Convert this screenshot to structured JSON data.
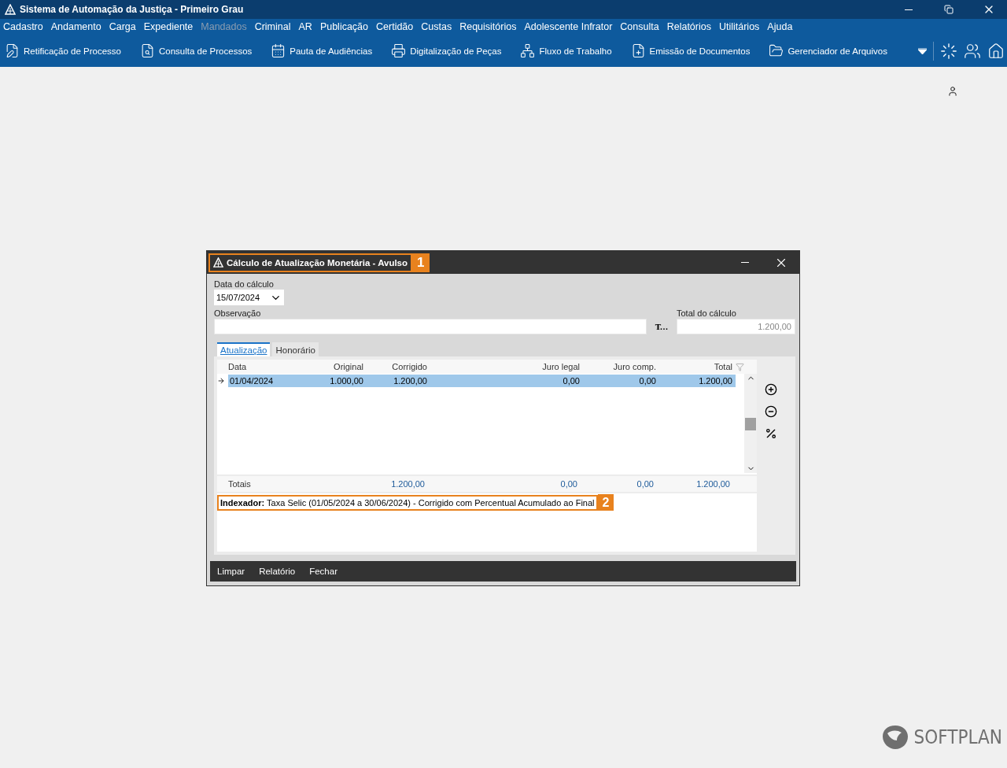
{
  "window": {
    "title": "Sistema de Automação da Justiça - Primeiro Grau"
  },
  "menu": [
    {
      "label": "Cadastro",
      "disabled": false
    },
    {
      "label": "Andamento",
      "disabled": false
    },
    {
      "label": "Carga",
      "disabled": false
    },
    {
      "label": "Expediente",
      "disabled": false
    },
    {
      "label": "Mandados",
      "disabled": true
    },
    {
      "label": "Criminal",
      "disabled": false
    },
    {
      "label": "AR",
      "disabled": false
    },
    {
      "label": "Publicação",
      "disabled": false
    },
    {
      "label": "Certidão",
      "disabled": false
    },
    {
      "label": "Custas",
      "disabled": false
    },
    {
      "label": "Requisitórios",
      "disabled": false
    },
    {
      "label": "Adolescente Infrator",
      "disabled": false
    },
    {
      "label": "Consulta",
      "disabled": false
    },
    {
      "label": "Relatórios",
      "disabled": false
    },
    {
      "label": "Utilitários",
      "disabled": false
    },
    {
      "label": "Ajuda",
      "disabled": false
    }
  ],
  "toolbar": [
    {
      "label": "Retificação de Processo",
      "kind": "edit"
    },
    {
      "label": "Consulta de Processos",
      "kind": "search"
    },
    {
      "label": "Pauta de Audiências",
      "kind": "calendar"
    },
    {
      "label": "Digitalização de Peças",
      "kind": "scanner"
    },
    {
      "label": "Fluxo de Trabalho",
      "kind": "flow"
    },
    {
      "label": "Emissão de Documentos",
      "kind": "document"
    },
    {
      "label": "Gerenciador de Arquivos",
      "kind": "folder"
    }
  ],
  "dialog": {
    "title": "Cálculo de Atualização Monetária - Avulso",
    "title_marker": "1",
    "date_label": "Data do cálculo",
    "date_value": "15/07/2024",
    "observation_label": "Observação",
    "text_button": "T...",
    "total_label": "Total do cálculo",
    "total_value": "1.200,00",
    "tabs": [
      {
        "label": "Atualização",
        "selected": true
      },
      {
        "label": "Honorário",
        "selected": false
      }
    ],
    "table": {
      "columns": [
        "Data",
        "Original",
        "Corrigido",
        "Juro legal",
        "Juro comp.",
        "Total"
      ],
      "rows": [
        {
          "cells": [
            "01/04/2024",
            "1.000,00",
            "1.200,00",
            "0,00",
            "0,00",
            "1.200,00"
          ],
          "selected": true
        }
      ],
      "totals": {
        "label": "Totais",
        "values": [
          "1.200,00",
          "0,00",
          "0,00",
          "1.200,00"
        ]
      }
    },
    "indexer": "**Indexador:** Taxa Selic (01/05/2024 a 30/06/2024) - Corrigido com Percentual Acumulado ao Final",
    "indexer_marker": "2",
    "buttons": [
      "Limpar",
      "Relatório",
      "Fechar"
    ]
  },
  "brand": "SOFTPLAN"
}
